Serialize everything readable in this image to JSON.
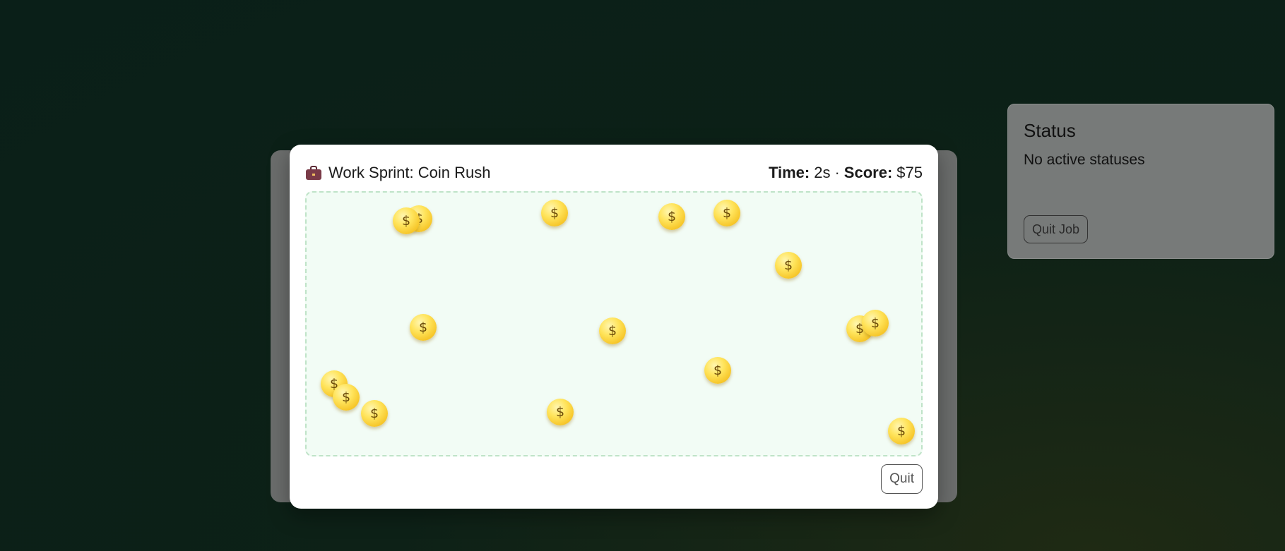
{
  "status_panel": {
    "title": "Status",
    "text": "No active statuses",
    "quit_job_label": "Quit Job"
  },
  "modal": {
    "icon": "briefcase-icon",
    "title": "Work Sprint: Coin Rush",
    "time_label": "Time:",
    "time_value": "2s",
    "separator": "·",
    "score_label": "Score:",
    "score_value": "$75",
    "quit_label": "Quit"
  },
  "coins": {
    "symbol": "$",
    "count": 17
  },
  "colors": {
    "coin": "#f6c528",
    "play_area_bg": "#f2fcf5",
    "play_area_border": "#bfe3c8"
  }
}
